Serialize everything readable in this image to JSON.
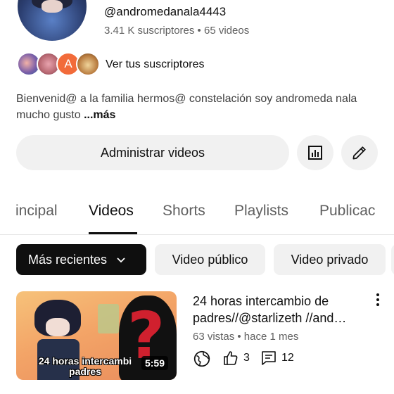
{
  "channel": {
    "handle": "@andromedanala4443",
    "stats": "3.41 K suscriptores • 65 videos"
  },
  "subscribers": {
    "label": "Ver tus suscriptores",
    "letter_avatar": "A"
  },
  "description": {
    "text": "Bienvenid@ a la familia hermos@ constelación soy andromeda nala mucho gusto ",
    "more": "...más"
  },
  "actions": {
    "manage_label": "Administrar videos",
    "analytics_icon": "analytics-icon",
    "edit_icon": "pencil-icon"
  },
  "tabs": [
    {
      "label": "incipal"
    },
    {
      "label": "Videos",
      "active": true
    },
    {
      "label": "Shorts"
    },
    {
      "label": "Playlists"
    },
    {
      "label": "Publicac"
    }
  ],
  "filters": {
    "sort_label": "Más recientes",
    "public_label": "Video público",
    "private_label": "Video privado"
  },
  "video": {
    "title": "24 horas intercambio de padres//@starlizeth //and…",
    "meta": "63 vistas • hace 1 mes",
    "duration": "5:59",
    "thumbnail_caption": "24 horas intercambi padres",
    "likes": "3",
    "comments": "12"
  },
  "colors": {
    "background": "#ffffff",
    "chip_active": "#0f0f0f",
    "chip": "#f1f1f1",
    "secondary_text": "#606060"
  }
}
